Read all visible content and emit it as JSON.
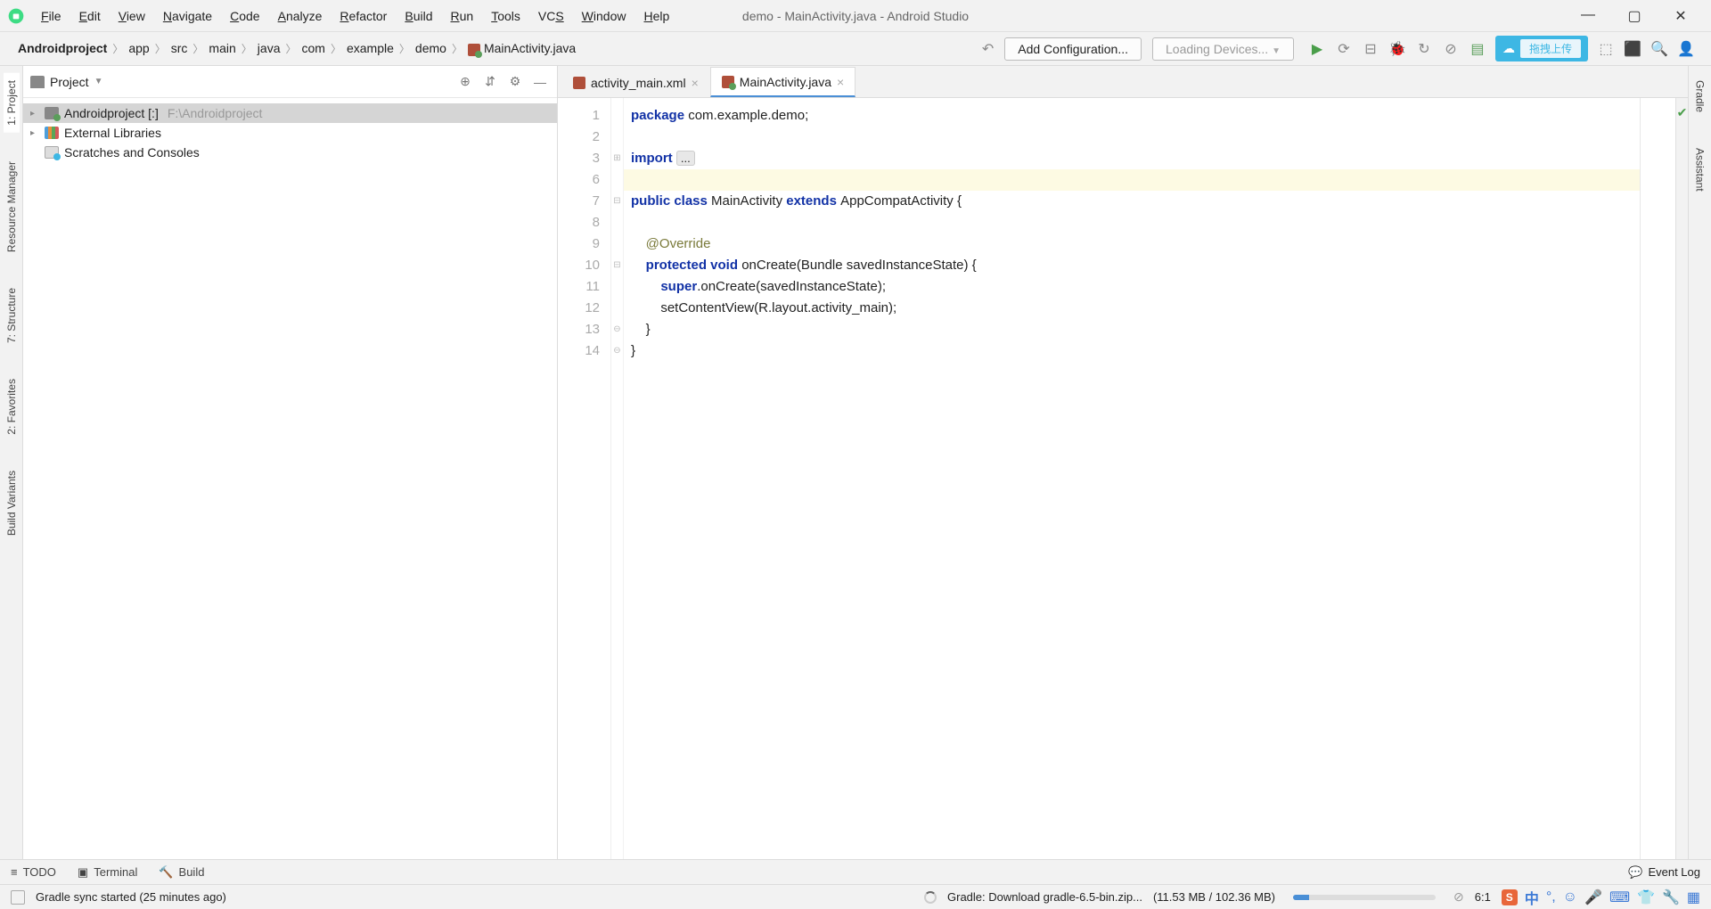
{
  "window": {
    "title": "demo - MainActivity.java - Android Studio"
  },
  "menu": [
    "File",
    "Edit",
    "View",
    "Navigate",
    "Code",
    "Analyze",
    "Refactor",
    "Build",
    "Run",
    "Tools",
    "VCS",
    "Window",
    "Help"
  ],
  "breadcrumb": [
    "Androidproject",
    "app",
    "src",
    "main",
    "java",
    "com",
    "example",
    "demo",
    "MainActivity.java"
  ],
  "config_button": "Add Configuration...",
  "device_dropdown": "Loading Devices...",
  "cloud_upload_label": "拖拽上传",
  "left_tabs": [
    {
      "label": "1: Project",
      "icon": "folder"
    },
    {
      "label": "Resource Manager",
      "icon": "image"
    },
    {
      "label": "7: Structure",
      "icon": "structure"
    },
    {
      "label": "2: Favorites",
      "icon": "star"
    },
    {
      "label": "Build Variants",
      "icon": "variant"
    }
  ],
  "right_tabs": [
    {
      "label": "Gradle",
      "icon": "gradle"
    },
    {
      "label": "Assistant",
      "icon": "list"
    }
  ],
  "project_panel": {
    "title": "Project",
    "tree": [
      {
        "label": "Androidproject [:]",
        "path": "F:\\Androidproject",
        "icon": "proj",
        "depth": 0,
        "selected": true,
        "arrow": "▸"
      },
      {
        "label": "External Libraries",
        "icon": "lib",
        "depth": 0,
        "arrow": "▸"
      },
      {
        "label": "Scratches and Consoles",
        "icon": "scratch",
        "depth": 0,
        "arrow": ""
      }
    ]
  },
  "tabs": [
    {
      "label": "activity_main.xml",
      "icon": "xml",
      "active": false
    },
    {
      "label": "MainActivity.java",
      "icon": "java",
      "active": true
    }
  ],
  "code": {
    "line_numbers": [
      1,
      2,
      3,
      6,
      7,
      8,
      9,
      10,
      11,
      12,
      13,
      14
    ],
    "hl_line_index": 3,
    "lines": [
      [
        {
          "t": "package ",
          "c": "kw"
        },
        {
          "t": "com.example.demo;"
        }
      ],
      [
        {
          "t": ""
        }
      ],
      [
        {
          "t": "import ",
          "c": "kw"
        },
        {
          "t": "...",
          "c": "fold"
        }
      ],
      [
        {
          "t": ""
        }
      ],
      [
        {
          "t": "public class ",
          "c": "kw"
        },
        {
          "t": "MainActivity "
        },
        {
          "t": "extends ",
          "c": "kw"
        },
        {
          "t": "AppCompatActivity {"
        }
      ],
      [
        {
          "t": ""
        }
      ],
      [
        {
          "t": "    "
        },
        {
          "t": "@Override",
          "c": "ann"
        }
      ],
      [
        {
          "t": "    "
        },
        {
          "t": "protected void ",
          "c": "kw"
        },
        {
          "t": "onCreate(Bundle savedInstanceState) {"
        }
      ],
      [
        {
          "t": "        "
        },
        {
          "t": "super",
          "c": "kw"
        },
        {
          "t": ".onCreate(savedInstanceState);"
        }
      ],
      [
        {
          "t": "        setContentView(R.layout.activity_main);"
        }
      ],
      [
        {
          "t": "    }"
        }
      ],
      [
        {
          "t": "}"
        }
      ]
    ]
  },
  "bottom_tools": [
    {
      "label": "TODO",
      "icon": "≡"
    },
    {
      "label": "Terminal",
      "icon": "▣"
    },
    {
      "label": "Build",
      "icon": "🔨"
    }
  ],
  "event_log_label": "Event Log",
  "status": {
    "sync_msg": "Gradle sync started (25 minutes ago)",
    "download_msg": "Gradle: Download gradle-6.5-bin.zip...",
    "download_size": "(11.53 MB / 102.36 MB)",
    "cursor": "6:1"
  },
  "tray_ime": "中"
}
